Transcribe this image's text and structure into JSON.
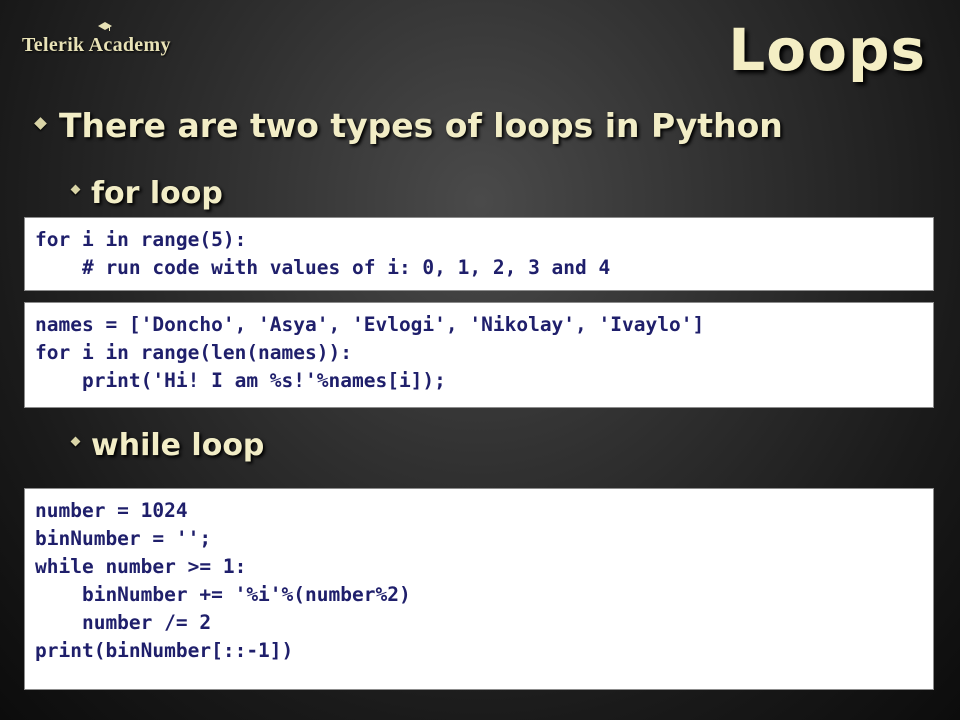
{
  "logo": {
    "text": "Telerik Academy"
  },
  "slide": {
    "title": "Loops"
  },
  "bullets": {
    "main": "There are two types of loops in Python",
    "for_label": "for loop",
    "while_label": "while loop"
  },
  "code_blocks": {
    "for_simple": [
      "for i in range(5):",
      "    # run code with values of i: 0, 1, 2, 3 and 4"
    ],
    "for_names": [
      "names = ['Doncho', 'Asya', 'Evlogi', 'Nikolay', 'Ivaylo']",
      "for i in range(len(names)):",
      "    print('Hi! I am %s!'%names[i]);"
    ],
    "while_binary": [
      "number = 1024",
      "binNumber = '';",
      "while number >= 1:",
      "    binNumber += '%i'%(number%2)",
      "    number /= 2",
      "print(binNumber[::-1])"
    ]
  },
  "colors": {
    "background": "#2e2e2e",
    "heading_text": "#f2edc6",
    "code_text": "#1f1f6b",
    "code_bg": "#ffffff"
  },
  "icons": {
    "logo_mark": "graduation-cap-icon",
    "bullet": "diamond-bullet-icon"
  }
}
